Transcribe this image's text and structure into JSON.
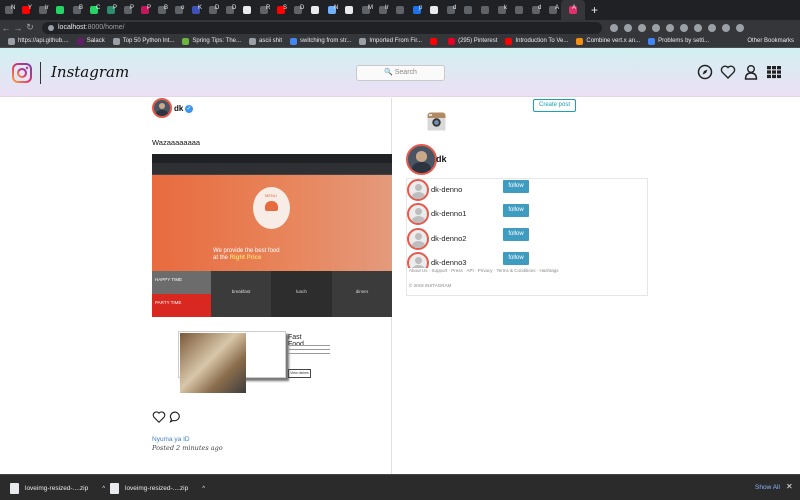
{
  "browser": {
    "tabs": [
      {
        "title": "N",
        "color": "#5f6368"
      },
      {
        "title": "Y",
        "color": "#ff0000"
      },
      {
        "title": "Ir",
        "color": "#5f6368"
      },
      {
        "title": "",
        "color": "#25d366"
      },
      {
        "title": "B",
        "color": "#5f6368"
      },
      {
        "title": "C",
        "color": "#25d366"
      },
      {
        "title": "P",
        "color": "#2c8c6c"
      },
      {
        "title": "P",
        "color": "#5f6368"
      },
      {
        "title": "P",
        "color": "#c2185b"
      },
      {
        "title": "B",
        "color": "#5f6368"
      },
      {
        "title": "o",
        "color": "#5f6368"
      },
      {
        "title": "K",
        "color": "#3f51b5"
      },
      {
        "title": "D",
        "color": "#5f6368"
      },
      {
        "title": "D",
        "color": "#5f6368"
      },
      {
        "title": "",
        "color": "#e8eaed"
      },
      {
        "title": "R",
        "color": "#5f6368"
      },
      {
        "title": "S",
        "color": "#ff0000"
      },
      {
        "title": "D",
        "color": "#5f6368"
      },
      {
        "title": "",
        "color": "#e8eaed"
      },
      {
        "title": "N",
        "color": "#6fb1ff"
      },
      {
        "title": "",
        "color": "#e8eaed"
      },
      {
        "title": "M",
        "color": "#5f6368"
      },
      {
        "title": "Ir",
        "color": "#5f6368"
      },
      {
        "title": "",
        "color": "#5f6368"
      },
      {
        "title": "p",
        "color": "#1a73e8"
      },
      {
        "title": "",
        "color": "#e8eaed"
      },
      {
        "title": "d",
        "color": "#5f6368"
      },
      {
        "title": "",
        "color": "#5f6368"
      },
      {
        "title": "",
        "color": "#5f6368"
      },
      {
        "title": "k",
        "color": "#5f6368"
      },
      {
        "title": "",
        "color": "#5f6368"
      },
      {
        "title": "d",
        "color": "#5f6368"
      },
      {
        "title": "A",
        "color": "#5f6368"
      },
      {
        "title": "A",
        "color": "#e1306c"
      }
    ],
    "url_host": "localhost",
    "url_path": ":8000/home/",
    "bookmarks": [
      {
        "label": "https://api.github....",
        "color": "#9aa0a6"
      },
      {
        "label": "Salack",
        "color": "#611f69"
      },
      {
        "label": "Top 50 Python Int...",
        "color": "#9aa0a6"
      },
      {
        "label": "Spring Tips: The...",
        "color": "#6db33f"
      },
      {
        "label": "ascii shit",
        "color": "#9aa0a6"
      },
      {
        "label": "switching from str...",
        "color": "#4285f4"
      },
      {
        "label": "Imported From Fir...",
        "color": "#9aa0a6"
      },
      {
        "label": "",
        "color": "#ff0000"
      },
      {
        "label": "(295) Pinterest",
        "color": "#e60023"
      },
      {
        "label": "Introduction To Ve...",
        "color": "#ff0000"
      },
      {
        "label": "Combine vert.x an...",
        "color": "#f29111"
      },
      {
        "label": "Problems by setti...",
        "color": "#4285f4"
      }
    ],
    "other_bookmarks": "Other Bookmarks"
  },
  "header": {
    "brand": "Instagram",
    "search_label": "🔍 Search",
    "icons": [
      "compass-icon",
      "heart-icon",
      "user-icon",
      "grid-icon"
    ]
  },
  "post": {
    "username": "dk",
    "verified_mark": "✓",
    "caption": "Wazaaaaaaaa",
    "image": {
      "menu_label": "MENU",
      "hero_line1": "We provide the best food",
      "hero_line2_prefix": "at the ",
      "hero_line2_bold": "Right Price",
      "happy": "HAPPY TIME",
      "party": "PARTY TIME",
      "breakfast": "breakfast",
      "lunch": "lunch",
      "dinner": "dinner"
    },
    "image2": {
      "title": "Fast Food",
      "button": "View dishes"
    },
    "comment_user": "Nyuma ya ID",
    "comment_time": "Posted 2 minutes ago"
  },
  "sidebar": {
    "create_post": "Create post",
    "username": "dk",
    "suggestions": [
      {
        "name": "dk-denno",
        "button": "follow"
      },
      {
        "name": "dk-denno1",
        "button": "follow"
      },
      {
        "name": "dk-denno2",
        "button": "follow"
      },
      {
        "name": "dk-denno3",
        "button": "follow"
      }
    ],
    "footer_links": "About Us · Support · Press · API · Privacy · Terms & Conditions · Hashtags",
    "copyright": "© 2018 INSTAGRAM"
  },
  "downloads": {
    "items": [
      {
        "name": "loveimg-resized-....zip"
      },
      {
        "name": "loveimg-resized-....zip"
      }
    ],
    "show_all": "Show All"
  }
}
